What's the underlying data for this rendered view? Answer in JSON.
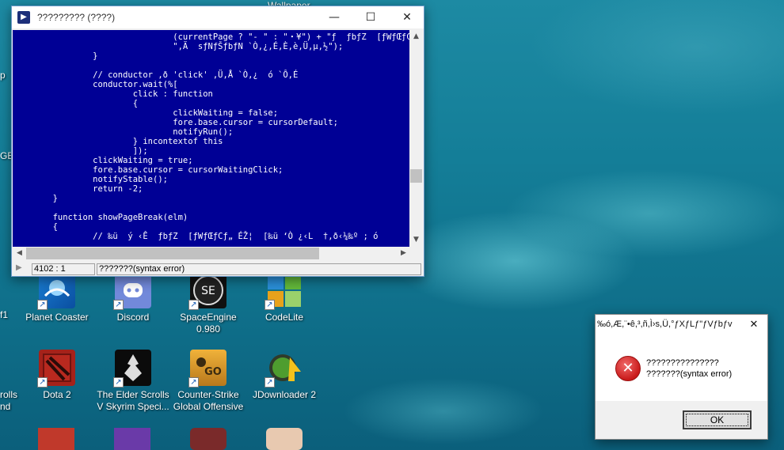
{
  "desktop": {
    "partial_top_label": "Wallpaper",
    "partial_left_labels": [
      "p",
      "GBo",
      "f1",
      "rolls",
      "nd"
    ],
    "icons": [
      {
        "label": "Planet Coaster",
        "icon": "planet-coaster-icon"
      },
      {
        "label": "Discord",
        "icon": "discord-icon"
      },
      {
        "label": "SpaceEngine 0.980",
        "icon": "spaceengine-icon"
      },
      {
        "label": "CodeLite",
        "icon": "codelite-icon"
      },
      {
        "label": "Dota 2",
        "icon": "dota2-icon"
      },
      {
        "label": "The Elder Scrolls V Skyrim Speci...",
        "icon": "skyrim-icon"
      },
      {
        "label": "Counter-Strike Global Offensive",
        "icon": "csgo-icon"
      },
      {
        "label": "JDownloader 2",
        "icon": "jdownloader-icon"
      }
    ]
  },
  "editor": {
    "title": "????????? (????)",
    "controls": {
      "minimize": "—",
      "maximize": "☐",
      "close": "✕"
    },
    "code_lines": [
      "                                (currentPage ? \"- \" : \"・¥\") + \"ƒ  ƒbƒZ  [ƒWƒŒƒCƒ„\" +",
      "                                \",Ä  sƒNƒŠƒbƒN `Ò,¿,É,È,è,Ü,µ,½\");",
      "                }",
      "",
      "                // conductor ,ð 'click' ,Ü,Å `Ò,¿  ó `Ô,É",
      "                conductor.wait(%[",
      "                        click : function",
      "                        {",
      "                                clickWaiting = false;",
      "                                fore.base.cursor = cursorDefault;",
      "                                notifyRun();",
      "                        } incontextof this",
      "                        ]);",
      "                clickWaiting = true;",
      "                fore.base.cursor = cursorWaitingClick;",
      "                notifyStable();",
      "                return -2;",
      "        }",
      "",
      "        function showPageBreak(elm)",
      "        {",
      "                // ‰ü  ý ‹Ê  ƒbƒZ  [ƒWƒŒƒCƒ„ ÉŽ¦  [‰ü ‘Ò ¿‹L  †,ð‹¼‰º ; ó"
    ],
    "cursor_position": "4102 : 1",
    "status_message": "???????(syntax error)"
  },
  "dialog": {
    "title": "‰ó,Æ,¨•ê,³,ñ,Ì›s,Ü,°ƒXƒLƒ\"ƒVƒbƒv",
    "line1": "???????????????",
    "line2": "???????(syntax error)",
    "ok_label": "OK"
  }
}
